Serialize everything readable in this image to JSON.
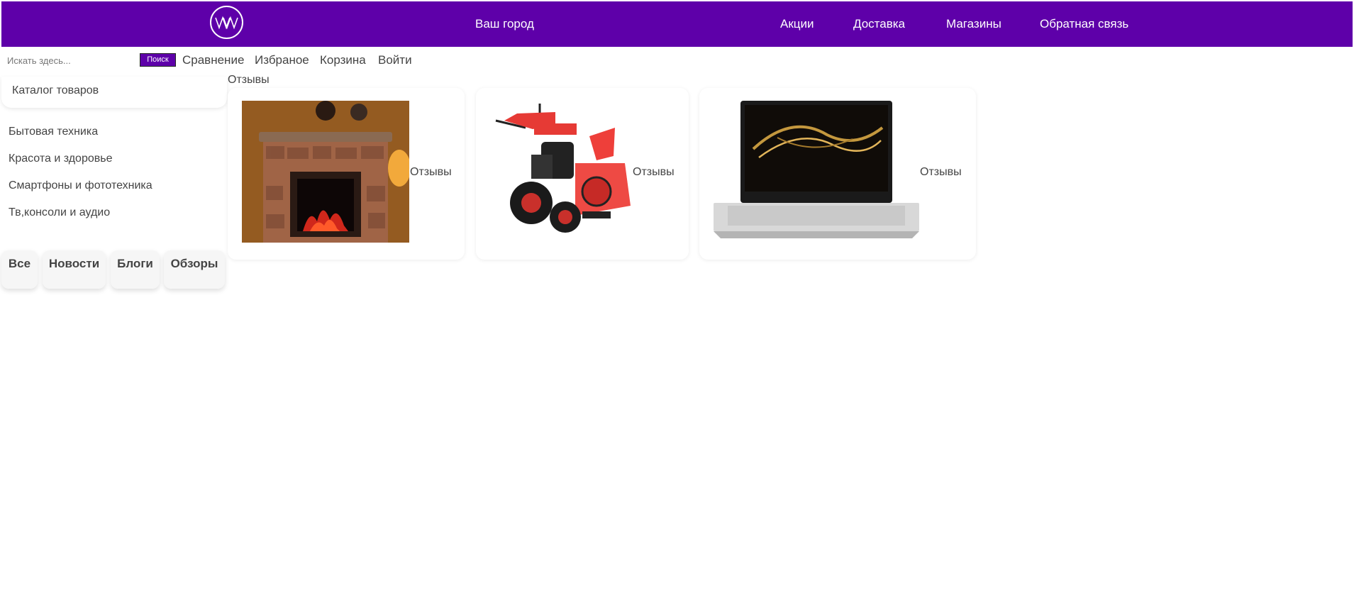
{
  "header": {
    "logo_text": "WW",
    "city": "Ваш город",
    "nav": [
      "Акции",
      "Доставка",
      "Магазины",
      "Обратная связь"
    ]
  },
  "search": {
    "placeholder": "Искать здесь...",
    "button": "Поиск"
  },
  "top_links": [
    "Сравнение",
    "Избраное",
    "Корзина",
    "Войти"
  ],
  "catalog": {
    "title": "Каталог товаров",
    "items": [
      "Бытовая техника",
      "Красота и здоровье",
      "Смартфоны и фототехника",
      "Тв,консоли и аудио"
    ]
  },
  "tags": [
    "Все",
    "Новости",
    "Блоги",
    "Обзоры"
  ],
  "reviews_label": "Отзывы",
  "products": [
    {
      "image": "fireplace-image",
      "label": "Отзывы"
    },
    {
      "image": "snowblower-image",
      "label": "Отзывы"
    },
    {
      "image": "laptop-image",
      "label": "Отзывы"
    }
  ],
  "colors": {
    "brand": "#5e00a9",
    "text": "#444444",
    "header_text": "#ffffff"
  }
}
